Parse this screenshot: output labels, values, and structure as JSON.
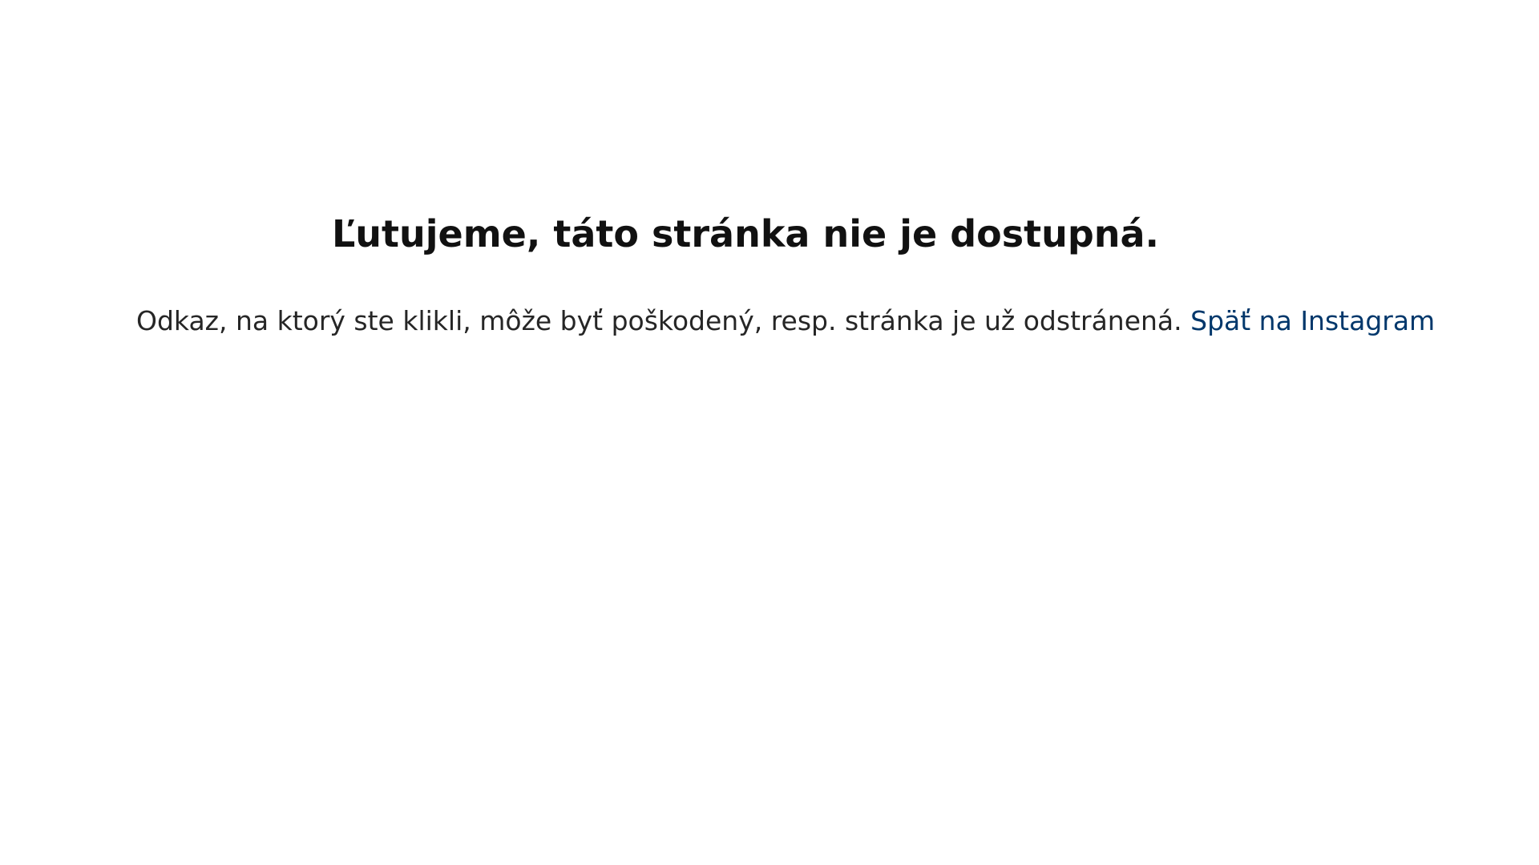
{
  "error": {
    "title": "Ľutujeme, táto stránka nie je dostupná.",
    "message": "Odkaz, na ktorý ste klikli, môže byť poškodený, resp. stránka je už odstránená.",
    "back_link_label": "Späť na Instagram"
  },
  "colors": {
    "background": "#ffffff",
    "title_text": "#111111",
    "body_text": "#262626",
    "link": "#00376b"
  }
}
